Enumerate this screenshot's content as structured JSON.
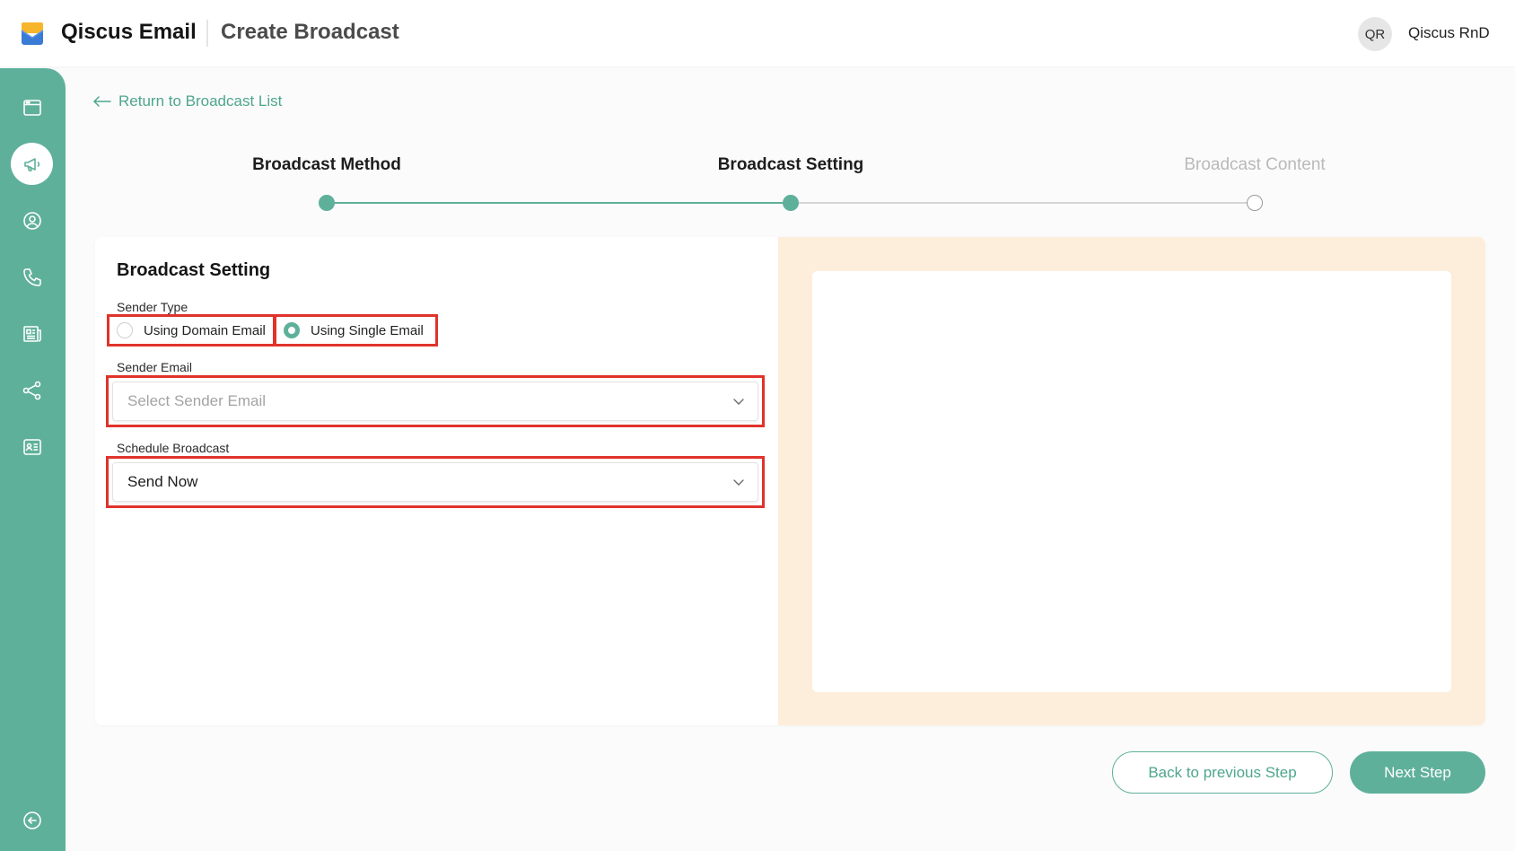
{
  "header": {
    "brand": "Qiscus Email",
    "page_title": "Create Broadcast",
    "avatar_initials": "QR",
    "user_name": "Qiscus RnD"
  },
  "sidebar": {
    "items": [
      {
        "icon": "window-icon",
        "active": false
      },
      {
        "icon": "megaphone-icon",
        "active": true
      },
      {
        "icon": "user-circle-icon",
        "active": false
      },
      {
        "icon": "phone-icon",
        "active": false
      },
      {
        "icon": "newspaper-icon",
        "active": false
      },
      {
        "icon": "share-nodes-icon",
        "active": false
      },
      {
        "icon": "contact-card-icon",
        "active": false
      }
    ],
    "collapse_icon": "arrow-left-circle-icon"
  },
  "back_link": "Return to Broadcast List",
  "stepper": {
    "steps": [
      {
        "label": "Broadcast Method",
        "state": "done"
      },
      {
        "label": "Broadcast Setting",
        "state": "current"
      },
      {
        "label": "Broadcast Content",
        "state": "upcoming"
      }
    ]
  },
  "form": {
    "title": "Broadcast Setting",
    "sender_type": {
      "label": "Sender Type",
      "options": [
        {
          "label": "Using Domain Email",
          "checked": false
        },
        {
          "label": "Using Single Email",
          "checked": true
        }
      ]
    },
    "sender_email": {
      "label": "Sender Email",
      "placeholder": "Select Sender Email"
    },
    "schedule": {
      "label": "Schedule Broadcast",
      "value": "Send Now"
    }
  },
  "buttons": {
    "back": "Back to previous Step",
    "next": "Next Step"
  },
  "colors": {
    "accent": "#5fb09a",
    "accent_text": "#4ea68d",
    "highlight": "#e0332b",
    "preview_bg": "#fdeedb"
  }
}
